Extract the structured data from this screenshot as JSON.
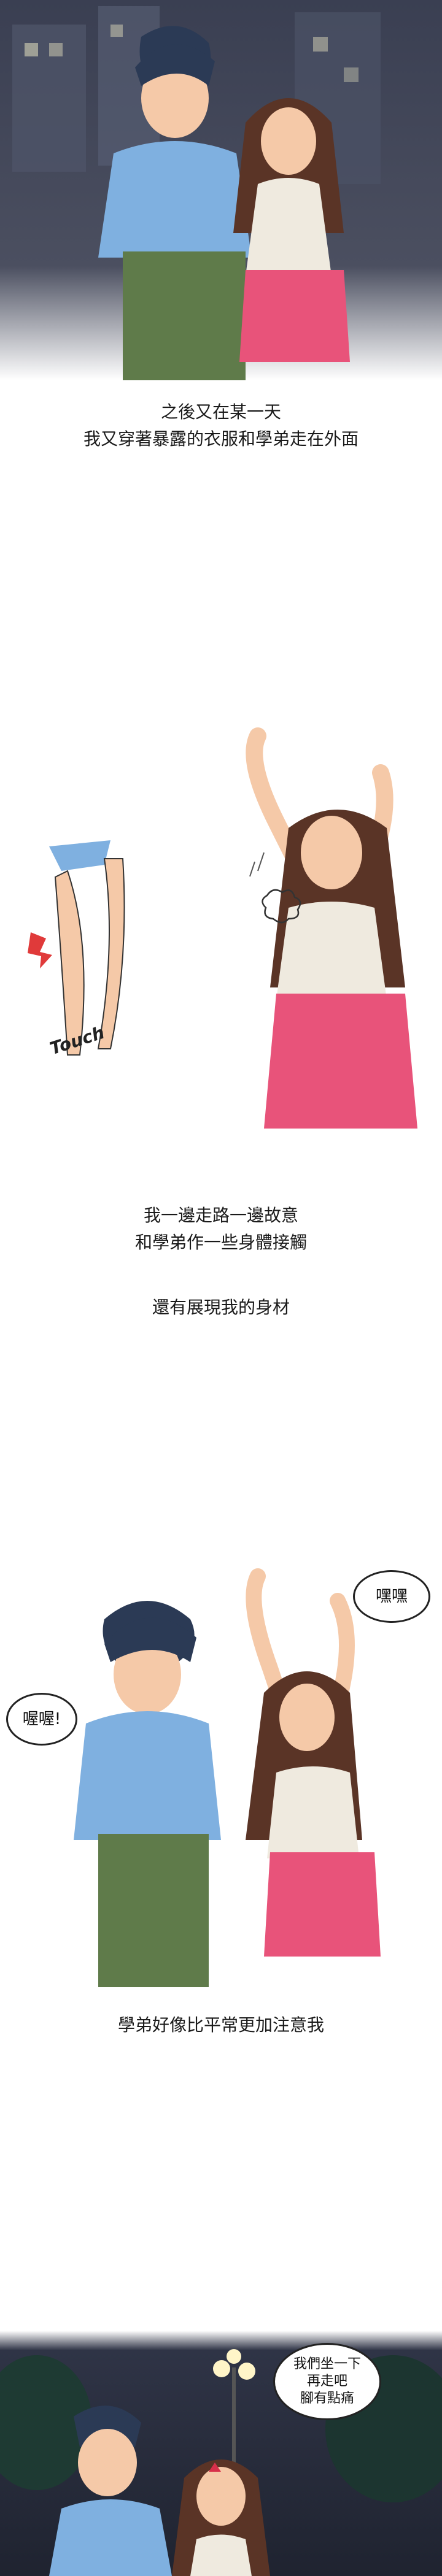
{
  "panels": {
    "night_walk": {
      "name": "night-walk-panel"
    },
    "touch": {
      "sfx": "Touch"
    },
    "reaction": {
      "bubble_boy": "喔喔!",
      "bubble_girl": "嘿嘿"
    },
    "night_park": {
      "bubble": [
        "我們坐一下",
        "再走吧",
        "腳有點痛"
      ]
    }
  },
  "captions": {
    "c1_line1": "之後又在某一天",
    "c1_line2": "我又穿著暴露的衣服和學弟走在外面",
    "c2_line1": "我一邊走路一邊故意",
    "c2_line2": "和學弟作一些身體接觸",
    "c3_line1": "還有展現我的身材",
    "c4_line1": "學弟好像比平常更加注意我"
  },
  "colors": {
    "night_sky": "#2c3142",
    "boy_shirt": "#7fb0e0",
    "boy_pants": "#5f7b4a",
    "girl_top": "#efeadf",
    "girl_skirt": "#e8537a",
    "girl_hair": "#5a3426",
    "boy_hair": "#2b3a55",
    "skin": "#f5c9a8"
  }
}
